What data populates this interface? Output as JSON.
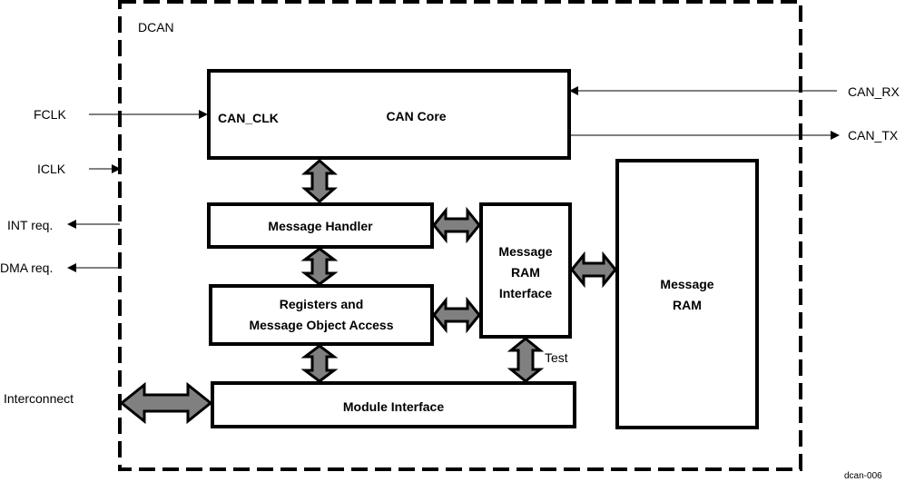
{
  "diagram": {
    "container_label": "DCAN",
    "figure_id": "dcan-006",
    "blocks": {
      "can_core": {
        "title": "CAN Core",
        "port_label": "CAN_CLK"
      },
      "message_handler": {
        "title": "Message Handler"
      },
      "registers": {
        "line1": "Registers and",
        "line2": "Message Object Access"
      },
      "msg_ram_interface": {
        "line1": "Message",
        "line2": "RAM",
        "line3": "Interface"
      },
      "module_interface": {
        "title": "Module Interface"
      },
      "message_ram": {
        "line1": "Message",
        "line2": "RAM"
      }
    },
    "signals": {
      "fclk": "FCLK",
      "iclk": "ICLK",
      "int_req": "INT req.",
      "dma_req": "DMA req.",
      "interconnect": "Interconnect",
      "can_rx": "CAN_RX",
      "can_tx": "CAN_TX",
      "test": "Test"
    },
    "colors": {
      "line": "#000000",
      "bus_arrow_fill": "#808080",
      "background": "#ffffff"
    }
  }
}
